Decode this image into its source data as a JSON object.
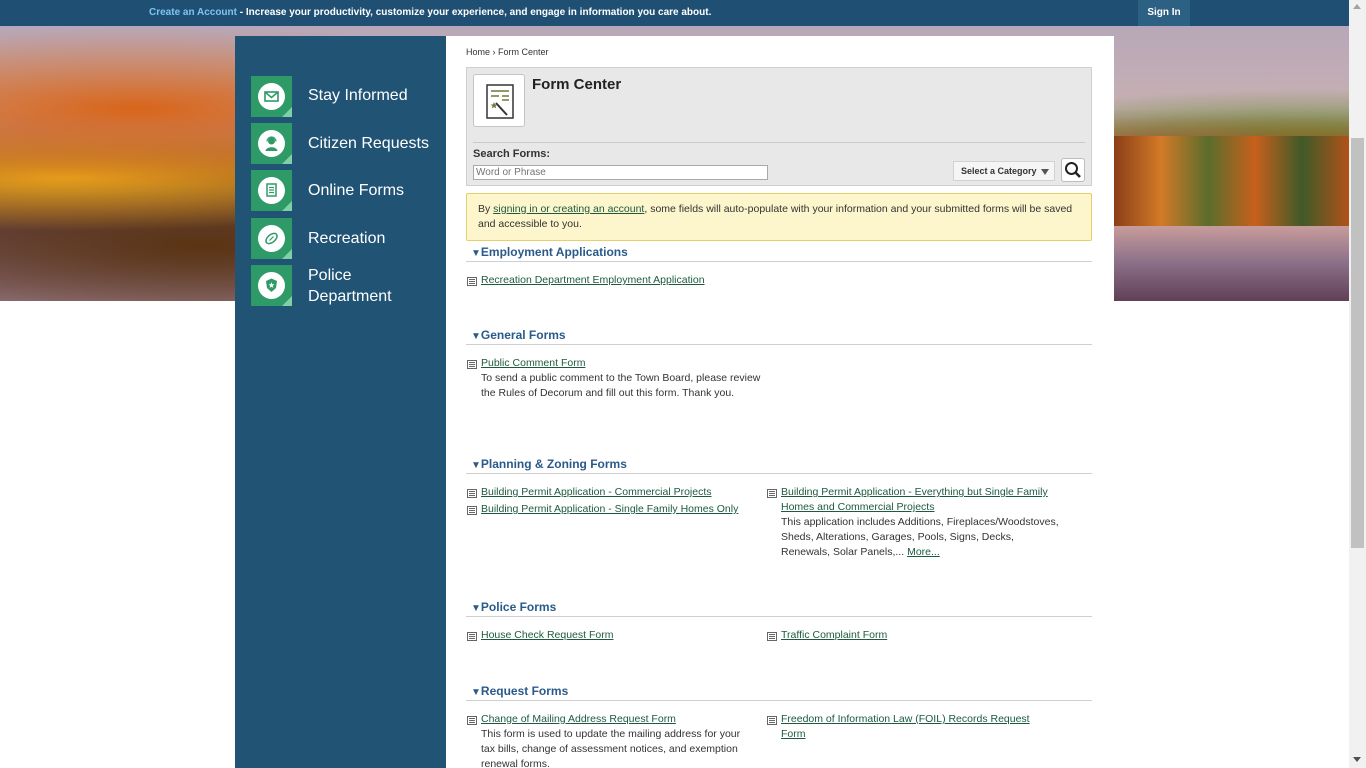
{
  "topbar": {
    "create_account": "Create an Account",
    "message": " - Increase your productivity, customize your experience, and engage in information you care about.",
    "sign_in": "Sign In"
  },
  "sidebar": {
    "items": [
      {
        "label": "Stay Informed",
        "icon": "envelope-icon"
      },
      {
        "label": "Citizen Requests",
        "icon": "person-headset-icon"
      },
      {
        "label": "Online Forms",
        "icon": "document-icon"
      },
      {
        "label": "Recreation",
        "icon": "football-icon"
      },
      {
        "label": "Police Department",
        "label_line1": "Police",
        "label_line2": "Department",
        "icon": "police-badge-icon"
      }
    ]
  },
  "breadcrumb": {
    "home": "Home",
    "separator": "›",
    "current": "Form Center"
  },
  "form_center": {
    "title": "Form Center",
    "search_label": "Search Forms:",
    "search_placeholder": "Word or Phrase",
    "category_select": "Select a Category"
  },
  "notice": {
    "prefix": "By ",
    "link": "signing in or creating an account",
    "suffix": ", some fields will auto-populate with your information and your submitted forms will be saved and accessible to you."
  },
  "sections": {
    "employment": {
      "title": "Employment Applications",
      "forms": [
        {
          "name": "Recreation Department Employment Application"
        }
      ]
    },
    "general": {
      "title": "General Forms",
      "forms": [
        {
          "name": "Public Comment Form",
          "description": "To send a public comment to the Town Board, please review the Rules of Decorum and fill out this form. Thank you."
        }
      ]
    },
    "planning": {
      "title": "Planning & Zoning Forms",
      "forms": [
        {
          "name": "Building Permit Application - Commercial Projects"
        },
        {
          "name": "Building Permit Application - Single Family Homes Only"
        },
        {
          "name": "Building Permit Application - Everything but Single Family Homes and Commercial Projects",
          "description": "This application includes Additions, Fireplaces/Woodstoves, Sheds, Alterations, Garages, Pools, Signs, Decks, Renewals, Solar Panels,...",
          "more": "More..."
        }
      ]
    },
    "police": {
      "title": "Police Forms",
      "forms": [
        {
          "name": "House Check Request Form"
        },
        {
          "name": "Traffic Complaint Form"
        }
      ]
    },
    "request": {
      "title": "Request Forms",
      "forms": [
        {
          "name": "Change of Mailing Address Request Form",
          "description": "This form is used to update the mailing address for your tax bills, change of assessment notices, and exemption renewal forms."
        },
        {
          "name": "Freedom of Information Law (FOIL) Records Request Form"
        }
      ]
    }
  },
  "colors": {
    "topbar": "#1f5074",
    "sidebar": "#215375",
    "nav_badge": "#2e9a68",
    "section_title": "#2a5a8a",
    "link": "#1d5a3f",
    "notice_bg": "#fdf5cc"
  }
}
